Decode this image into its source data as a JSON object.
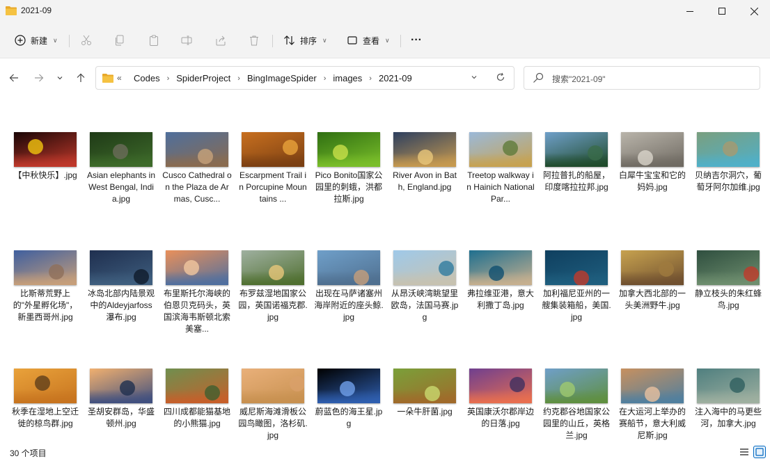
{
  "window": {
    "title": "2021-09",
    "folder_color": "#f5c242"
  },
  "toolbar": {
    "new_label": "新建",
    "sort_label": "排序",
    "view_label": "查看",
    "more_label": "···"
  },
  "address": {
    "more": "«",
    "crumbs": [
      "Codes",
      "SpiderProject",
      "BingImageSpider",
      "images",
      "2021-09"
    ]
  },
  "search": {
    "placeholder": "搜索\"2021-09\""
  },
  "files": [
    {
      "name": "【中秋快乐】.jpg",
      "colors": [
        "#1a0606",
        "#c0392b",
        "#f1c40f"
      ]
    },
    {
      "name": "Asian elephants in West Bengal, India.jpg",
      "colors": [
        "#1f3a17",
        "#3e6b2a",
        "#6b6b5a"
      ]
    },
    {
      "name": "Cusco Cathedral on the Plaza de Armas, Cusc...",
      "colors": [
        "#4f6f9c",
        "#8a6b4f",
        "#c7a37a"
      ]
    },
    {
      "name": "Escarpment Trail in Porcupine Mountains ...",
      "colors": [
        "#c76f1f",
        "#7a3f12",
        "#e9a23b"
      ]
    },
    {
      "name": "Pico Bonito国家公园里的刺蛾，洪都拉斯.jpg",
      "colors": [
        "#2f6f12",
        "#7bbf2a",
        "#c8e04a"
      ]
    },
    {
      "name": "River Avon in Bath, England.jpg",
      "colors": [
        "#2d3f5f",
        "#c79a4f",
        "#e8c77a"
      ]
    },
    {
      "name": "Treetop walkway in Hainich National Par...",
      "colors": [
        "#9bb9d9",
        "#c7a24f",
        "#5f7a3a"
      ]
    },
    {
      "name": "阿拉普扎的船屋，印度喀拉拉邦.jpg",
      "colors": [
        "#6f9fc9",
        "#1f4a2a",
        "#3a6b4a"
      ]
    },
    {
      "name": "白犀牛宝宝和它的妈妈.jpg",
      "colors": [
        "#b9b4aa",
        "#6f6a62",
        "#d9d4ca"
      ]
    },
    {
      "name": "贝纳吉尔洞穴，葡萄牙阿尔加维.jpg",
      "colors": [
        "#7a9f7f",
        "#4fb0c9",
        "#a89a6f"
      ]
    },
    {
      "name": "比斯蒂荒野上的\"外星孵化场\"，新墨西哥州.jpg",
      "colors": [
        "#3f5f9f",
        "#c79f7a",
        "#8f6f5a"
      ]
    },
    {
      "name": "冰岛北部内陆景观中的Aldeyjarfoss瀑布.jpg",
      "colors": [
        "#1f2f4f",
        "#3f5f7f",
        "#0f1a2a"
      ]
    },
    {
      "name": "布里斯托尔海峡的伯恩贝克码头，英国滨海韦斯顿北索美塞...",
      "colors": [
        "#e9905a",
        "#4f6f9f",
        "#f1c79f"
      ]
    },
    {
      "name": "布罗兹湿地国家公园，英国诺福克郡.jpg",
      "colors": [
        "#9fb0a0",
        "#4f6f2f",
        "#e9c77a"
      ]
    },
    {
      "name": "出现在马萨诸塞州海岸附近的座头鲸.jpg",
      "colors": [
        "#6f9fc9",
        "#4f6f8f",
        "#c79f7a"
      ]
    },
    {
      "name": "从昂沃峡湾眺望里欧岛，法国马赛.jpg",
      "colors": [
        "#9fc9e9",
        "#c7c2b0",
        "#2f7a9f"
      ]
    },
    {
      "name": "弗拉维亚港，意大利撒丁岛.jpg",
      "colors": [
        "#1f6f8f",
        "#c7b08f",
        "#0f4f6f"
      ]
    },
    {
      "name": "加利福尼亚州的一艘集装箱船，美国.jpg",
      "colors": [
        "#0f3f5f",
        "#1f5f7f",
        "#c0392b"
      ]
    },
    {
      "name": "加拿大西北部的一头美洲野牛.jpg",
      "colors": [
        "#c7a24f",
        "#6f4f2f",
        "#9f7a3f"
      ]
    },
    {
      "name": "静立枝头的朱红蜂鸟.jpg",
      "colors": [
        "#2f4f3f",
        "#6f8f6f",
        "#c0392b"
      ]
    },
    {
      "name": "秋季在湿地上空迁徙的椋鸟群.jpg",
      "colors": [
        "#e9a23b",
        "#c7741f",
        "#5f3f1a"
      ]
    },
    {
      "name": "圣胡安群岛，华盛顿州.jpg",
      "colors": [
        "#f1b06f",
        "#3f4f7f",
        "#1f2f4f"
      ]
    },
    {
      "name": "四川成都能猫基地的小熊猫.jpg",
      "colors": [
        "#6f8f4f",
        "#c75f2a",
        "#3f5f2f"
      ]
    },
    {
      "name": "威尼斯海滩滑板公园鸟瞰图，洛杉矶.jpg",
      "colors": [
        "#e9b07a",
        "#c7904f",
        "#d9a06a"
      ]
    },
    {
      "name": "蔚蓝色的海王星.jpg",
      "colors": [
        "#000000",
        "#2f5fb0",
        "#6f9fe9"
      ]
    },
    {
      "name": "一朵牛肝菌.jpg",
      "colors": [
        "#7aa03a",
        "#a06a2a",
        "#c9d96f"
      ]
    },
    {
      "name": "英国康沃尔郡岸边的日落.jpg",
      "colors": [
        "#6f3f8f",
        "#e96f4f",
        "#3f2f5f"
      ]
    },
    {
      "name": "约克郡谷地国家公园里的山丘，英格兰.jpg",
      "colors": [
        "#6f9fc9",
        "#5f8f3f",
        "#9fc96f"
      ]
    },
    {
      "name": "在大运河上举办的赛船节，意大利威尼斯.jpg",
      "colors": [
        "#c7905f",
        "#4f7f9f",
        "#e9c09f"
      ]
    },
    {
      "name": "注入海中的马更些河，加拿大.jpg",
      "colors": [
        "#4f7f7f",
        "#9fb0a0",
        "#2f5f5f"
      ]
    }
  ],
  "status": {
    "count_text": "30 个项目"
  },
  "colors": {
    "accent": "#0067c0",
    "chrome_bg": "#f3f3f3"
  }
}
